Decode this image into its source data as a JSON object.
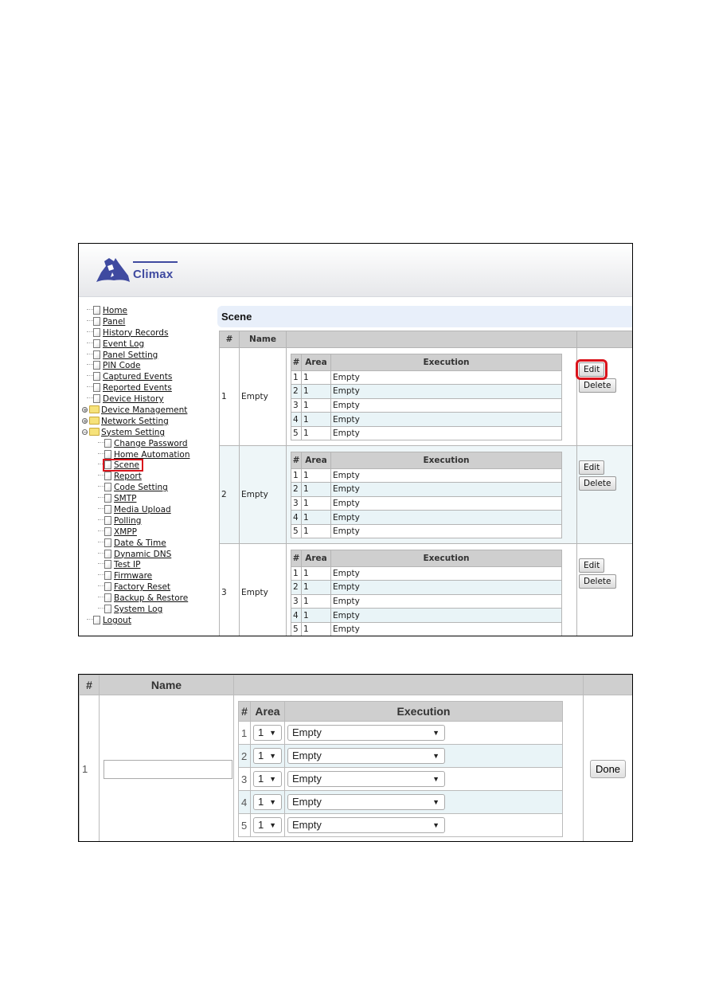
{
  "brand": {
    "name": "Climax",
    "logo_color": "#3f4aa0"
  },
  "highlight_color": "#d9131b",
  "sidebar": {
    "items": [
      {
        "label": "Home",
        "type": "page",
        "level": 0
      },
      {
        "label": "Panel",
        "type": "page",
        "level": 0
      },
      {
        "label": "History Records",
        "type": "page",
        "level": 0
      },
      {
        "label": "Event Log",
        "type": "page",
        "level": 0
      },
      {
        "label": "Panel Setting",
        "type": "page",
        "level": 0
      },
      {
        "label": "PIN Code",
        "type": "page",
        "level": 0
      },
      {
        "label": "Captured Events",
        "type": "page",
        "level": 0
      },
      {
        "label": "Reported Events",
        "type": "page",
        "level": 0
      },
      {
        "label": "Device History",
        "type": "page",
        "level": 0
      },
      {
        "label": "Device Management",
        "type": "folder",
        "level": 0,
        "expanded": false
      },
      {
        "label": "Network Setting",
        "type": "folder",
        "level": 0,
        "expanded": false
      },
      {
        "label": "System Setting",
        "type": "folder",
        "level": 0,
        "expanded": true
      },
      {
        "label": "Change Password",
        "type": "page",
        "level": 1
      },
      {
        "label": "Home Automation",
        "type": "page",
        "level": 1
      },
      {
        "label": "Scene",
        "type": "page",
        "level": 1,
        "highlighted": true
      },
      {
        "label": "Report",
        "type": "page",
        "level": 1
      },
      {
        "label": "Code Setting",
        "type": "page",
        "level": 1
      },
      {
        "label": "SMTP",
        "type": "page",
        "level": 1
      },
      {
        "label": "Media Upload",
        "type": "page",
        "level": 1
      },
      {
        "label": "Polling",
        "type": "page",
        "level": 1
      },
      {
        "label": "XMPP",
        "type": "page",
        "level": 1
      },
      {
        "label": "Date & Time",
        "type": "page",
        "level": 1
      },
      {
        "label": "Dynamic DNS",
        "type": "page",
        "level": 1
      },
      {
        "label": "Test IP",
        "type": "page",
        "level": 1
      },
      {
        "label": "Firmware",
        "type": "page",
        "level": 1
      },
      {
        "label": "Factory Reset",
        "type": "page",
        "level": 1
      },
      {
        "label": "Backup & Restore",
        "type": "page",
        "level": 1
      },
      {
        "label": "System Log",
        "type": "page",
        "level": 1
      },
      {
        "label": "Logout",
        "type": "page",
        "level": 0
      }
    ]
  },
  "scene_page": {
    "title": "Scene",
    "columns": {
      "num": "#",
      "name": "Name",
      "details": "",
      "actions": ""
    },
    "sub_columns": {
      "num": "#",
      "area": "Area",
      "execution": "Execution"
    },
    "edit_label": "Edit",
    "delete_label": "Delete",
    "scenes": [
      {
        "num": "1",
        "name": "Empty",
        "edit_highlighted": true,
        "rows": [
          {
            "num": "1",
            "area": "1",
            "execution": "Empty"
          },
          {
            "num": "2",
            "area": "1",
            "execution": "Empty"
          },
          {
            "num": "3",
            "area": "1",
            "execution": "Empty"
          },
          {
            "num": "4",
            "area": "1",
            "execution": "Empty"
          },
          {
            "num": "5",
            "area": "1",
            "execution": "Empty"
          }
        ]
      },
      {
        "num": "2",
        "name": "Empty",
        "rows": [
          {
            "num": "1",
            "area": "1",
            "execution": "Empty"
          },
          {
            "num": "2",
            "area": "1",
            "execution": "Empty"
          },
          {
            "num": "3",
            "area": "1",
            "execution": "Empty"
          },
          {
            "num": "4",
            "area": "1",
            "execution": "Empty"
          },
          {
            "num": "5",
            "area": "1",
            "execution": "Empty"
          }
        ]
      },
      {
        "num": "3",
        "name": "Empty",
        "rows": [
          {
            "num": "1",
            "area": "1",
            "execution": "Empty"
          },
          {
            "num": "2",
            "area": "1",
            "execution": "Empty"
          },
          {
            "num": "3",
            "area": "1",
            "execution": "Empty"
          },
          {
            "num": "4",
            "area": "1",
            "execution": "Empty"
          },
          {
            "num": "5",
            "area": "1",
            "execution": "Empty"
          }
        ]
      }
    ]
  },
  "edit_form": {
    "columns": {
      "num": "#",
      "name": "Name",
      "details": "",
      "actions": ""
    },
    "sub_columns": {
      "num": "#",
      "area": "Area",
      "execution": "Execution"
    },
    "scene_num": "1",
    "name_value": "",
    "done_label": "Done",
    "rows": [
      {
        "num": "1",
        "area": "1",
        "execution": "Empty"
      },
      {
        "num": "2",
        "area": "1",
        "execution": "Empty"
      },
      {
        "num": "3",
        "area": "1",
        "execution": "Empty"
      },
      {
        "num": "4",
        "area": "1",
        "execution": "Empty"
      },
      {
        "num": "5",
        "area": "1",
        "execution": "Empty"
      }
    ]
  }
}
